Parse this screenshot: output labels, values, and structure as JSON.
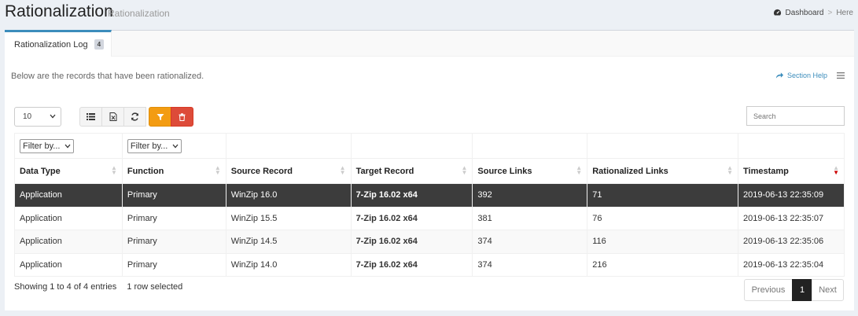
{
  "header": {
    "title": "Rationalization",
    "subtitle": "Rationalization"
  },
  "breadcrumb": {
    "home": "Dashboard",
    "sep": ">",
    "current": "Here"
  },
  "tab": {
    "label": "Rationalization Log",
    "count": "4"
  },
  "description": "Below are the records that have been rationalized.",
  "help_label": "Section Help",
  "page_length": "10",
  "search_placeholder": "Search",
  "filters": {
    "data_type": "Filter by...",
    "function": "Filter by..."
  },
  "columns": [
    "Data Type",
    "Function",
    "Source Record",
    "Target Record",
    "Source Links",
    "Rationalized Links",
    "Timestamp"
  ],
  "rows": [
    [
      "Application",
      "Primary",
      "WinZip 16.0",
      "7-Zip 16.02 x64",
      "392",
      "71",
      "2019-06-13 22:35:09"
    ],
    [
      "Application",
      "Primary",
      "WinZip 15.5",
      "7-Zip 16.02 x64",
      "381",
      "76",
      "2019-06-13 22:35:07"
    ],
    [
      "Application",
      "Primary",
      "WinZip 14.5",
      "7-Zip 16.02 x64",
      "374",
      "116",
      "2019-06-13 22:35:06"
    ],
    [
      "Application",
      "Primary",
      "WinZip 14.0",
      "7-Zip 16.02 x64",
      "374",
      "216",
      "2019-06-13 22:35:04"
    ]
  ],
  "footer": {
    "info": "Showing 1 to 4 of 4 entries",
    "selected": "1 row selected"
  },
  "pagination": {
    "previous": "Previous",
    "current": "1",
    "next": "Next"
  },
  "colors": {
    "accent": "#3c8dbc",
    "filter_button": "#f39c12",
    "delete_button": "#dd4b39",
    "selected_row": "#3c3c3c"
  }
}
